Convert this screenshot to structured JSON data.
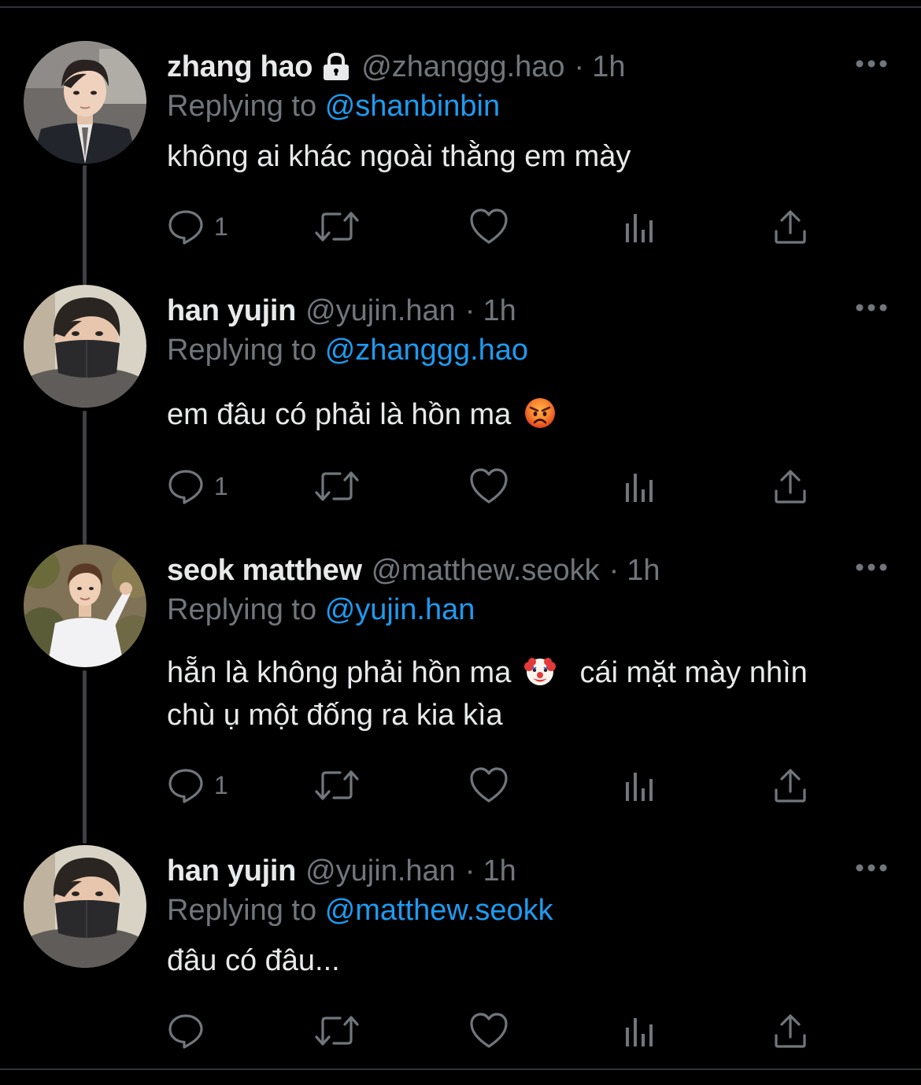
{
  "tweets": [
    {
      "display_name": "zhang hao",
      "protected": true,
      "handle": "@zhanggg.hao",
      "separator": "·",
      "time": "1h",
      "replying_prefix": "Replying to",
      "replying_to": "@shanbinbin",
      "text_lines": [
        "không ai khác ngoài thằng em mày"
      ],
      "reply_count": "1",
      "avatar": "avatar-zhang-hao"
    },
    {
      "display_name": "han yujin",
      "protected": false,
      "handle": "@yujin.han",
      "separator": "·",
      "time": "1h",
      "replying_prefix": "Replying to",
      "replying_to": "@zhanggg.hao",
      "text_lines": [
        "em đâu có phải là hồn ma"
      ],
      "emoji": "angry-face-emoji",
      "reply_count": "1",
      "avatar": "avatar-han-yujin"
    },
    {
      "display_name": "seok matthew",
      "protected": false,
      "handle": "@matthew.seokk",
      "separator": "·",
      "time": "1h",
      "replying_prefix": "Replying to",
      "replying_to": "@yujin.han",
      "text_lines": [
        "hẵn là không phải hồn ma",
        "cái mặt mày nhìn",
        "chù ụ một đống ra kia kìa"
      ],
      "emoji": "clown-face-emoji",
      "reply_count": "1",
      "avatar": "avatar-seok-matthew"
    },
    {
      "display_name": "han yujin",
      "protected": false,
      "handle": "@yujin.han",
      "separator": "·",
      "time": "1h",
      "replying_prefix": "Replying to",
      "replying_to": "@matthew.seokk",
      "text_lines": [
        "đâu có đâu..."
      ],
      "reply_count": "",
      "avatar": "avatar-han-yujin"
    }
  ],
  "icons": {
    "reply": "reply-icon",
    "retweet": "retweet-icon",
    "like": "heart-icon",
    "views": "views-icon",
    "share": "share-icon",
    "more": "more-icon",
    "lock": "lock-icon"
  },
  "colors": {
    "background": "#000000",
    "primary_text": "#e7e9ea",
    "secondary_text": "#71767b",
    "link": "#1d9bf0",
    "thread_line": "#3e4144"
  }
}
